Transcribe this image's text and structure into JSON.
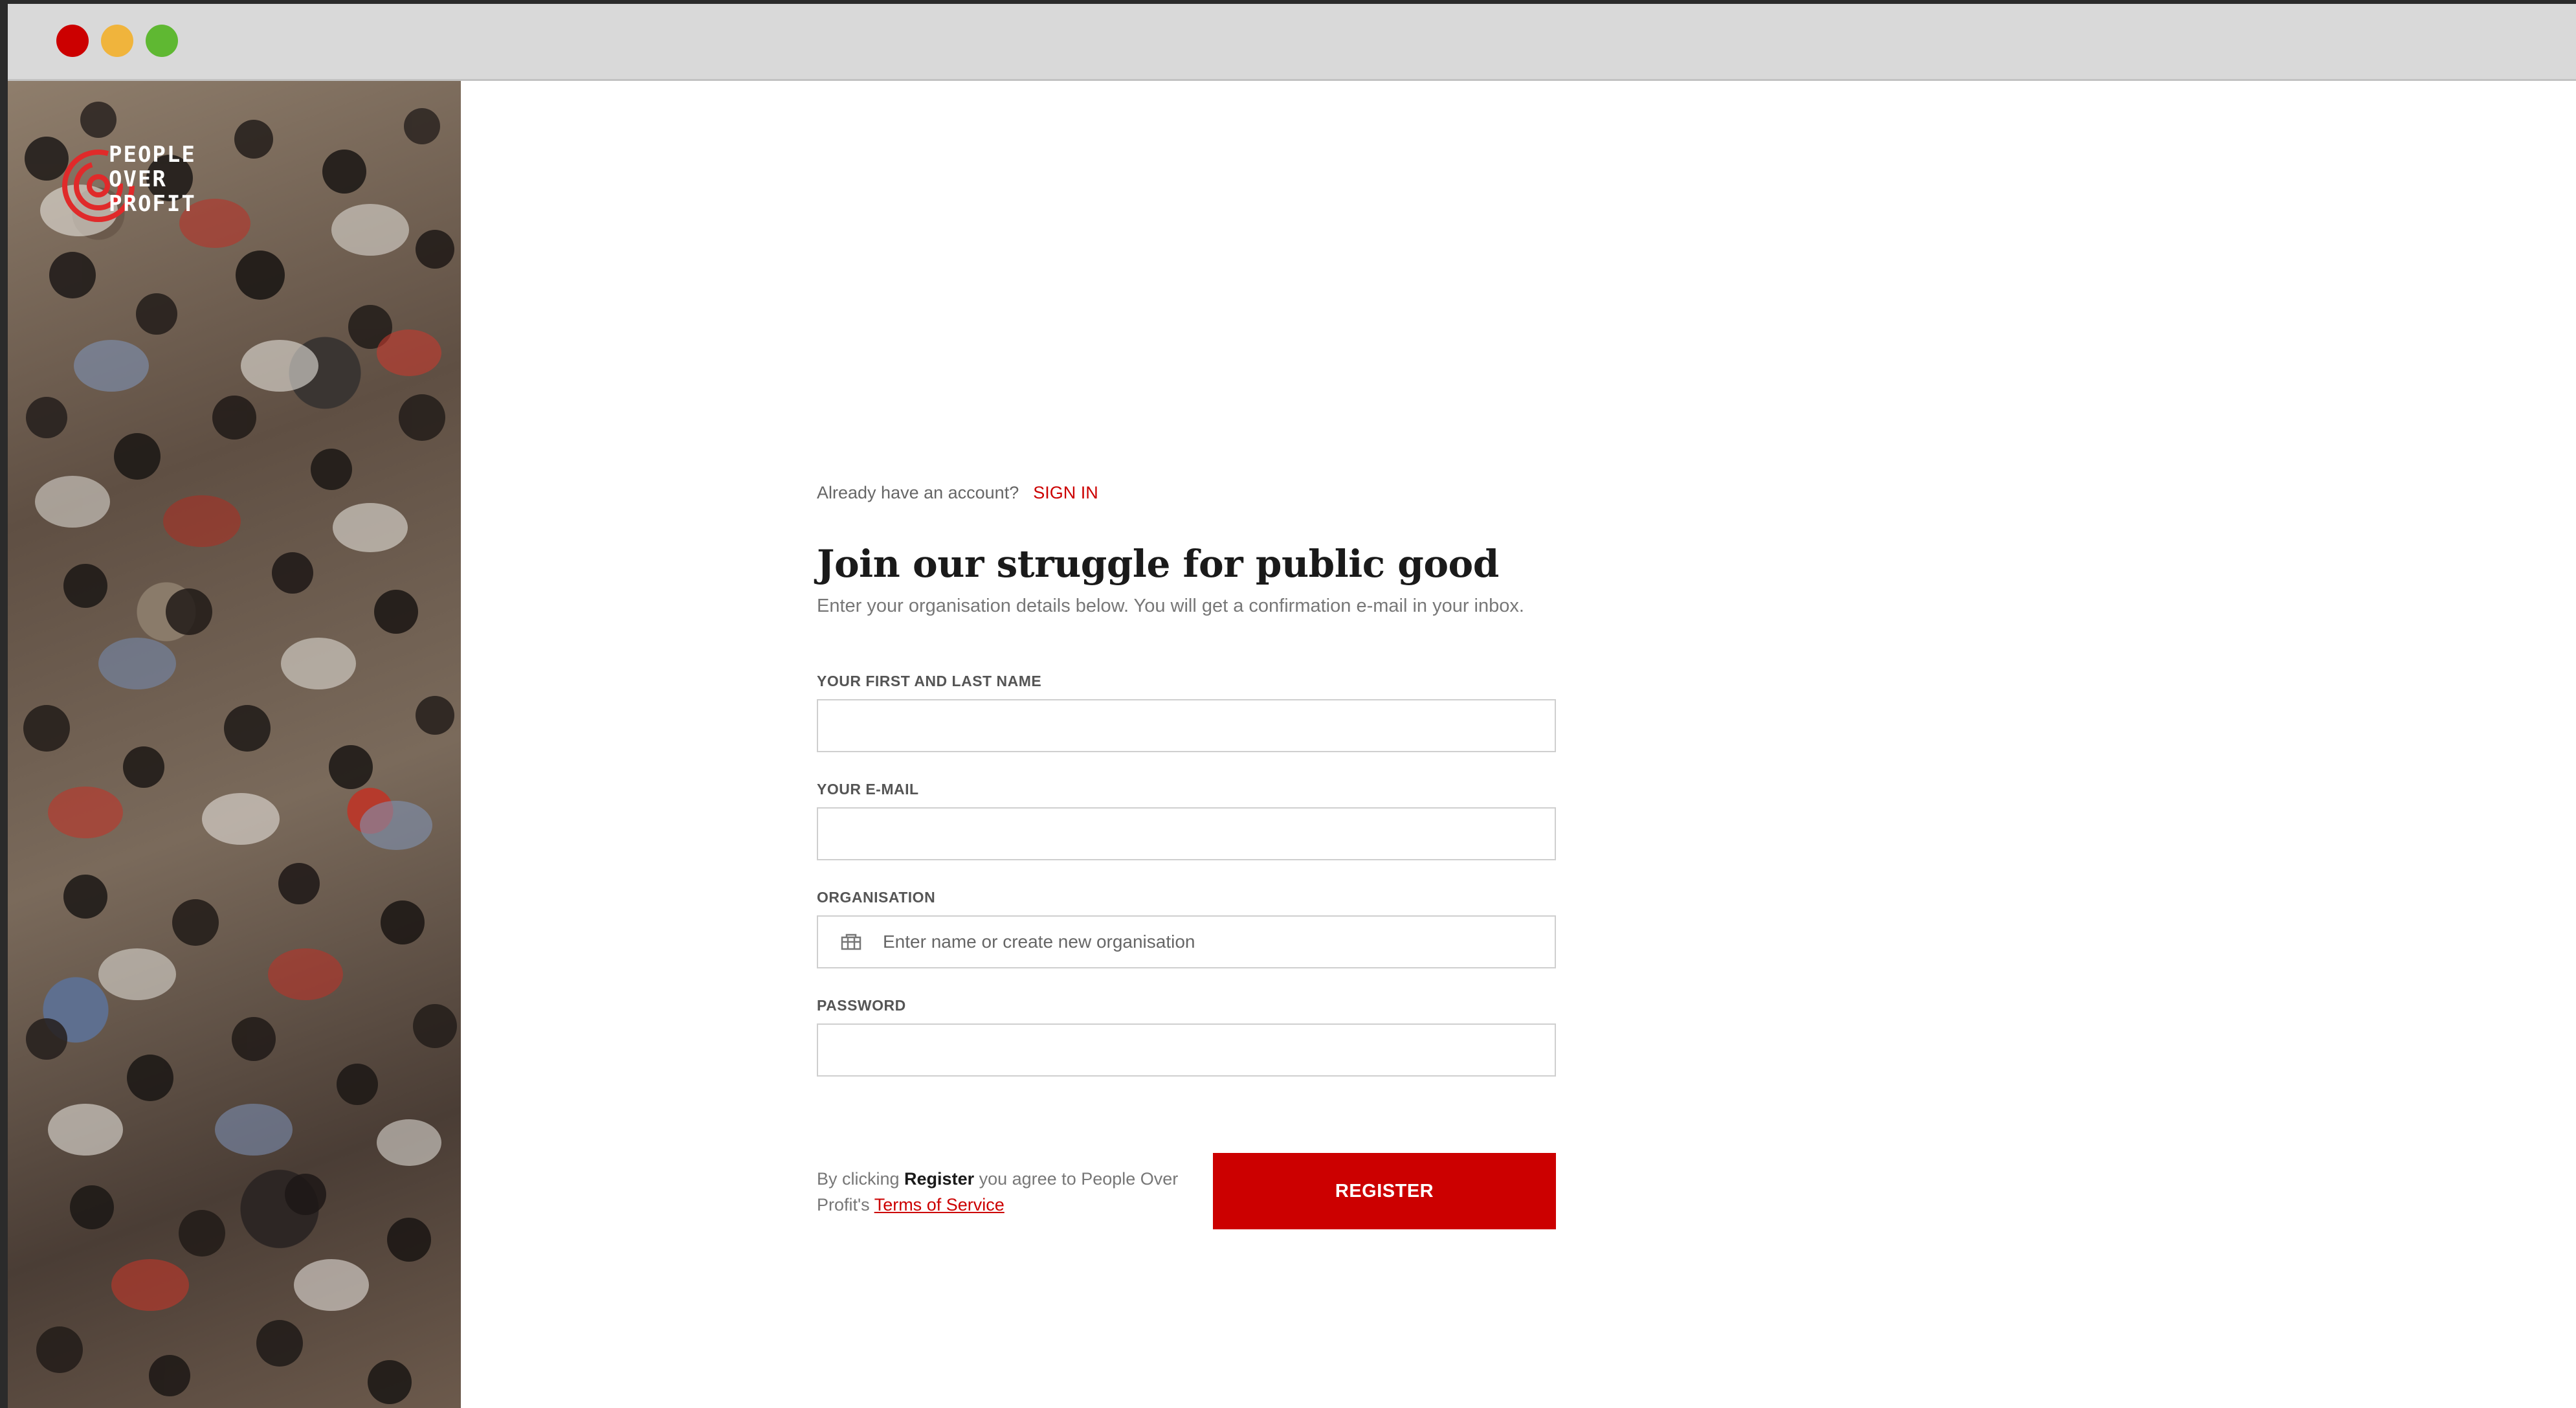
{
  "brand": {
    "name_lines": "PEOPLE\nOVER\nPROFIT",
    "colors": {
      "accent": "#cc0000",
      "text_dark": "#1a1a1a",
      "text_muted": "#777777"
    }
  },
  "window_controls": [
    "close",
    "minimize",
    "maximize"
  ],
  "signin": {
    "prompt": "Already have an account?",
    "link": "SIGN IN"
  },
  "form": {
    "title": "Join our struggle for public good",
    "subtitle": "Enter your organisation details below. You will get a confirmation e-mail in your inbox.",
    "fields": {
      "name_label": "YOUR FIRST AND LAST NAME",
      "name_value": "",
      "email_label": "YOUR E-MAIL",
      "email_value": "",
      "org_label": "ORGANISATION",
      "org_placeholder": "Enter name or create new organisation",
      "org_icon": "building-icon",
      "password_label": "PASSWORD",
      "password_value": ""
    },
    "terms": {
      "prefix": "By clicking ",
      "bold": "Register",
      "middle": " you agree to People Over Profit's ",
      "link": "Terms of Service"
    },
    "register_label": "REGISTER"
  }
}
